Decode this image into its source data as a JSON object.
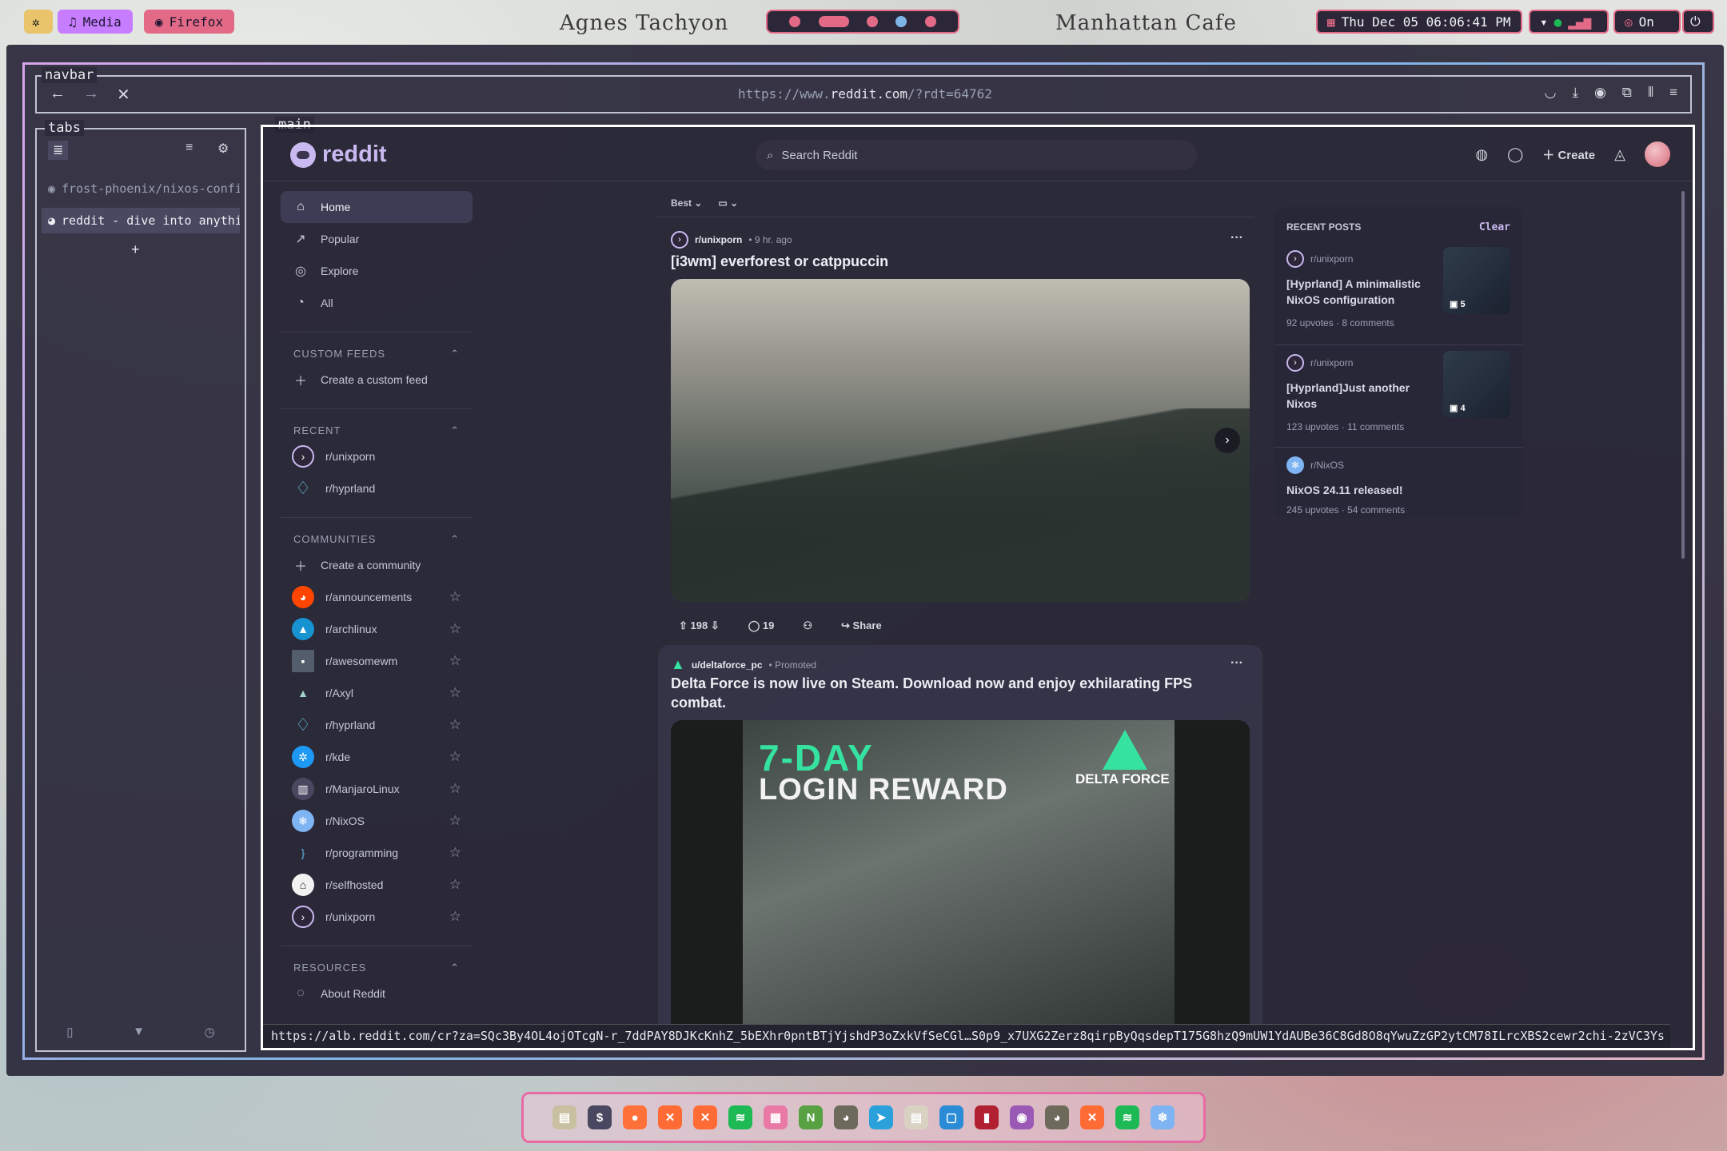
{
  "topbar": {
    "settings_icon": "gear-icon",
    "media_label": "Media",
    "firefox_label": "Firefox",
    "title_left": "Agnes Tachyon",
    "title_right": "Manhattan Cafe",
    "clock": "Thu Dec 05  06:06:41 PM",
    "status_on": "On"
  },
  "browser": {
    "navbar_tag": "navbar",
    "tabs_tag": "tabs",
    "main_tag": "main",
    "url_prefix": "https://www.",
    "url_domain": "reddit.com",
    "url_suffix": "/?rdt=64762",
    "tabs": [
      {
        "label": "frost-phoenix/nixos-config",
        "icon": "github-icon"
      },
      {
        "label": "reddit - dive into anything",
        "icon": "reddit-icon"
      }
    ],
    "new_tab": "+",
    "status_url": "https://alb.reddit.com/cr?za=SQc3By4OL4ojOTcgN-r_7ddPAY8DJKcKnhZ_5bEXhr0pntBTjYjshdP3oZxkVfSeCGl…S0p9_x7UXG2Zerz8qirpByQqsdepT175G8hzQ9mUW1YdAUBe36C8Gd8O8qYwuZzGP2ytCM78ILrcXBS2cewr2chi-2zVC3Ys"
  },
  "reddit": {
    "logo": "reddit",
    "search_placeholder": "Search Reddit",
    "create_label": "Create",
    "nav": [
      {
        "label": "Home",
        "icon": "home-icon",
        "active": true
      },
      {
        "label": "Popular",
        "icon": "popular-icon"
      },
      {
        "label": "Explore",
        "icon": "explore-icon"
      },
      {
        "label": "All",
        "icon": "all-icon"
      }
    ],
    "custom_feeds": {
      "title": "CUSTOM FEEDS",
      "create": "Create a custom feed"
    },
    "recent": {
      "title": "RECENT",
      "items": [
        "r/unixporn",
        "r/hyprland"
      ]
    },
    "communities": {
      "title": "COMMUNITIES",
      "create": "Create a community",
      "items": [
        {
          "name": "r/announcements",
          "color": "#ff4500"
        },
        {
          "name": "r/archlinux",
          "color": "#1793d1"
        },
        {
          "name": "r/awesomewm",
          "color": "#535d6c"
        },
        {
          "name": "r/Axyl",
          "color": "#2b2738"
        },
        {
          "name": "r/hyprland",
          "color": "#2b2738"
        },
        {
          "name": "r/kde",
          "color": "#1d99f3"
        },
        {
          "name": "r/ManjaroLinux",
          "color": "#4a4760"
        },
        {
          "name": "r/NixOS",
          "color": "#7eb4f2"
        },
        {
          "name": "r/programming",
          "color": "#2b2738"
        },
        {
          "name": "r/selfhosted",
          "color": "#f2f2f2"
        },
        {
          "name": "r/unixporn",
          "color": "#2b2738"
        }
      ]
    },
    "resources": {
      "title": "RESOURCES",
      "first": "About Reddit"
    },
    "sort": {
      "label": "Best"
    },
    "post1": {
      "subreddit": "r/unixporn",
      "age": "• 9 hr. ago",
      "title": "[i3wm] everforest or catppuccin",
      "upvotes": "198",
      "comments": "19",
      "share": "Share",
      "more": "···"
    },
    "post2": {
      "author": "u/deltaforce_pc",
      "promoted": "• Promoted",
      "title": "Delta Force is now live on Steam. Download now and enjoy exhilarating FPS combat.",
      "promo_line1": "7-DAY",
      "promo_line2": "LOGIN REWARD",
      "brand": "DELTA FORCE",
      "more": "···"
    },
    "recent_posts": {
      "title": "RECENT POSTS",
      "clear": "Clear",
      "items": [
        {
          "sub": "r/unixporn",
          "title": "[Hyprland] A minimalistic NixOS configuration",
          "upvotes": "92 upvotes",
          "comments": "8 comments",
          "images": "5"
        },
        {
          "sub": "r/unixporn",
          "title": "[Hyprland]Just another Nixos",
          "upvotes": "123 upvotes",
          "comments": "11 comments",
          "images": "4"
        },
        {
          "sub": "r/NixOS",
          "title": "NixOS 24.11 released!",
          "upvotes": "245 upvotes",
          "comments": "54 comments"
        }
      ]
    }
  },
  "dock": {
    "apps": [
      {
        "icon": "files-icon",
        "color": "#c8c0a0",
        "glyph": "▤"
      },
      {
        "icon": "terminal-icon",
        "color": "#4a4760",
        "glyph": "$"
      },
      {
        "icon": "firefox-icon",
        "color": "#ff7139",
        "glyph": "●"
      },
      {
        "icon": "x-app-icon",
        "color": "#ff6b35",
        "glyph": "✕"
      },
      {
        "icon": "x-app-icon",
        "color": "#ff6b35",
        "glyph": "✕"
      },
      {
        "icon": "spotify-icon",
        "color": "#1db954",
        "glyph": "≋"
      },
      {
        "icon": "image-viewer-icon",
        "color": "#e87aa5",
        "glyph": "▦"
      },
      {
        "icon": "neovim-icon",
        "color": "#57a143",
        "glyph": "N"
      },
      {
        "icon": "cat-icon",
        "color": "#6d6a5c",
        "glyph": "◕"
      },
      {
        "icon": "telegram-icon",
        "color": "#2aa1da",
        "glyph": "➤"
      },
      {
        "icon": "notes-icon",
        "color": "#d9d2c3",
        "glyph": "▤"
      },
      {
        "icon": "screenshot-icon",
        "color": "#2a8bd6",
        "glyph": "▢"
      },
      {
        "icon": "book-icon",
        "color": "#b02030",
        "glyph": "▮"
      },
      {
        "icon": "media-icon",
        "color": "#9b59b6",
        "glyph": "◉"
      },
      {
        "icon": "cat-icon",
        "color": "#6d6a5c",
        "glyph": "◕"
      },
      {
        "icon": "x-app-icon",
        "color": "#ff6b35",
        "glyph": "✕"
      },
      {
        "icon": "spotify-icon",
        "color": "#1db954",
        "glyph": "≋"
      },
      {
        "icon": "nixos-icon",
        "color": "#7eb4f2",
        "glyph": "❄"
      }
    ]
  }
}
